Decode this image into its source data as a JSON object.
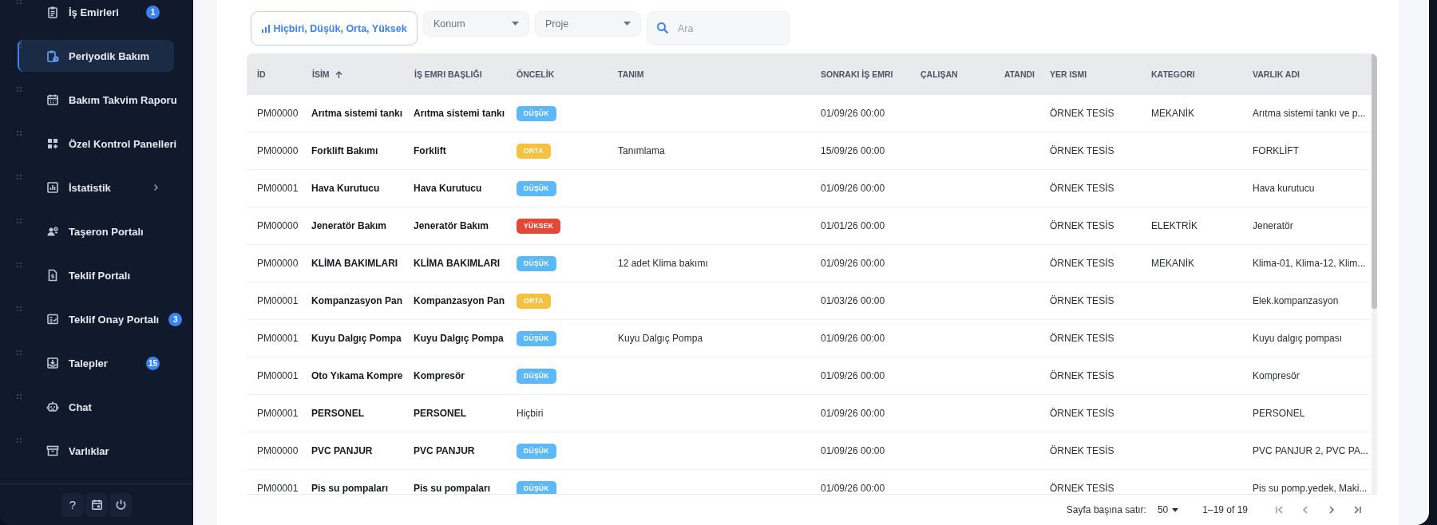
{
  "sidebar": {
    "items": [
      {
        "label": "İş Emirleri",
        "selected": false,
        "expandable": false,
        "badge": "1"
      },
      {
        "label": "Periyodik Bakım",
        "selected": true,
        "expandable": false
      },
      {
        "label": "Bakım Takvim Raporu",
        "selected": false,
        "expandable": false
      },
      {
        "label": "Özel Kontrol Panelleri",
        "selected": false,
        "expandable": false
      },
      {
        "label": "İstatistik",
        "selected": false,
        "expandable": true
      },
      {
        "label": "Taşeron Portalı",
        "selected": false,
        "expandable": false
      },
      {
        "label": "Teklif Portalı",
        "selected": false,
        "expandable": false
      },
      {
        "label": "Teklif Onay Portalı",
        "selected": false,
        "expandable": false,
        "badge": "3"
      },
      {
        "label": "Talepler",
        "selected": false,
        "expandable": false,
        "badge": "15"
      },
      {
        "label": "Chat",
        "selected": false,
        "expandable": false
      },
      {
        "label": "Varlıklar",
        "selected": false,
        "expandable": false
      }
    ],
    "help_button": "?"
  },
  "filters": {
    "priority": "Hiçbiri, Düşük, Orta, Yüksek",
    "location": {
      "placeholder": "Konum"
    },
    "project": {
      "placeholder": "Proje"
    },
    "search": {
      "placeholder": "Ara"
    }
  },
  "table": {
    "columns": [
      {
        "label": "İD",
        "sorted": false
      },
      {
        "label": "İSİM",
        "sorted": true
      },
      {
        "label": "İŞ EMRI BAŞLIĞI",
        "sorted": false
      },
      {
        "label": "ÖNCELİK",
        "sorted": false
      },
      {
        "label": "TANIM",
        "sorted": false
      },
      {
        "label": "SONRAKI İŞ EMRI",
        "sorted": false
      },
      {
        "label": "ÇALIŞAN",
        "sorted": false
      },
      {
        "label": "ATANDI",
        "sorted": false
      },
      {
        "label": "YER ISMI",
        "sorted": false
      },
      {
        "label": "KATEGORI",
        "sorted": false
      },
      {
        "label": "VARLIK ADI",
        "sorted": false
      }
    ],
    "rows": [
      {
        "id": "PM00000",
        "name": "Arıtma sistemi tankı",
        "title": "Arıtma sistemi tankı",
        "priority": {
          "kind": "low",
          "label": "DÜŞÜK"
        },
        "next_work_order": "01/09/26 00:00",
        "location": "ÖRNEK TESİS",
        "category": "MEKANİK",
        "asset": "Arıtma sistemi tankı ve p..."
      },
      {
        "id": "PM00000",
        "name": "Forklift Bakımı",
        "title": "Forklift",
        "priority": {
          "kind": "medium",
          "label": "ORTA"
        },
        "description": "Tanımlama",
        "next_work_order": "15/09/26 00:00",
        "location": "ÖRNEK TESİS",
        "asset": "FORKLİFT"
      },
      {
        "id": "PM00001",
        "name": "Hava Kurutucu",
        "title": "Hava Kurutucu",
        "priority": {
          "kind": "low",
          "label": "DÜŞÜK"
        },
        "next_work_order": "01/09/26 00:00",
        "location": "ÖRNEK TESİS",
        "asset": "Hava kurutucu"
      },
      {
        "id": "PM00000",
        "name": "Jeneratör Bakım",
        "title": "Jeneratör Bakım",
        "priority": {
          "kind": "high",
          "label": "YÜKSEK"
        },
        "next_work_order": "01/01/26 00:00",
        "location": "ÖRNEK TESİS",
        "category": "ELEKTRİK",
        "asset": "Jeneratör"
      },
      {
        "id": "PM00000",
        "name": "KLİMA BAKIMLARI",
        "title": "KLİMA BAKIMLARI",
        "priority": {
          "kind": "low",
          "label": "DÜŞÜK"
        },
        "description": "12 adet Klima bakımı",
        "next_work_order": "01/09/26 00:00",
        "location": "ÖRNEK TESİS",
        "category": "MEKANİK",
        "asset": "Klima-01, Klima-12, Klim..."
      },
      {
        "id": "PM00001",
        "name": "Kompanzasyon Pan",
        "title": "Kompanzasyon Pan",
        "priority": {
          "kind": "medium",
          "label": "ORTA"
        },
        "next_work_order": "01/03/26 00:00",
        "location": "ÖRNEK TESİS",
        "asset": "Elek.kompanzasyon"
      },
      {
        "id": "PM00001",
        "name": "Kuyu Dalgıç Pompa",
        "title": "Kuyu Dalgıç Pompa",
        "priority": {
          "kind": "low",
          "label": "DÜŞÜK"
        },
        "description": "Kuyu Dalgıç Pompa",
        "next_work_order": "01/09/26 00:00",
        "location": "ÖRNEK TESİS",
        "asset": "Kuyu dalgıç pompası"
      },
      {
        "id": "PM00001",
        "name": "Oto Yıkama Kompre",
        "title": "Kompresör",
        "priority": {
          "kind": "low",
          "label": "DÜŞÜK"
        },
        "next_work_order": "01/09/26 00:00",
        "location": "ÖRNEK TESİS",
        "asset": "Kompresör"
      },
      {
        "id": "PM00001",
        "name": "PERSONEL",
        "title": "PERSONEL",
        "priority": {
          "kind": "none",
          "label": "Hiçbiri"
        },
        "next_work_order": "01/09/26 00:00",
        "location": "ÖRNEK TESİS",
        "asset": "PERSONEL"
      },
      {
        "id": "PM00000",
        "name": "PVC PANJUR",
        "title": "PVC PANJUR",
        "priority": {
          "kind": "low",
          "label": "DÜŞÜK"
        },
        "next_work_order": "01/09/26 00:00",
        "location": "ÖRNEK TESİS",
        "asset": "PVC PANJUR 2, PVC PA..."
      },
      {
        "id": "PM00001",
        "name": "Pis su pompaları",
        "title": "Pis su pompaları",
        "priority": {
          "kind": "low",
          "label": "DÜŞÜK"
        },
        "next_work_order": "01/09/26 00:00",
        "location": "ÖRNEK TESİS",
        "asset": "Pis su pomp.yedek, Maki..."
      }
    ]
  },
  "pagination": {
    "rows_per_page_label": "Sayfa başına satır:",
    "rows_per_page": "50",
    "range": "1–19 of 19"
  }
}
